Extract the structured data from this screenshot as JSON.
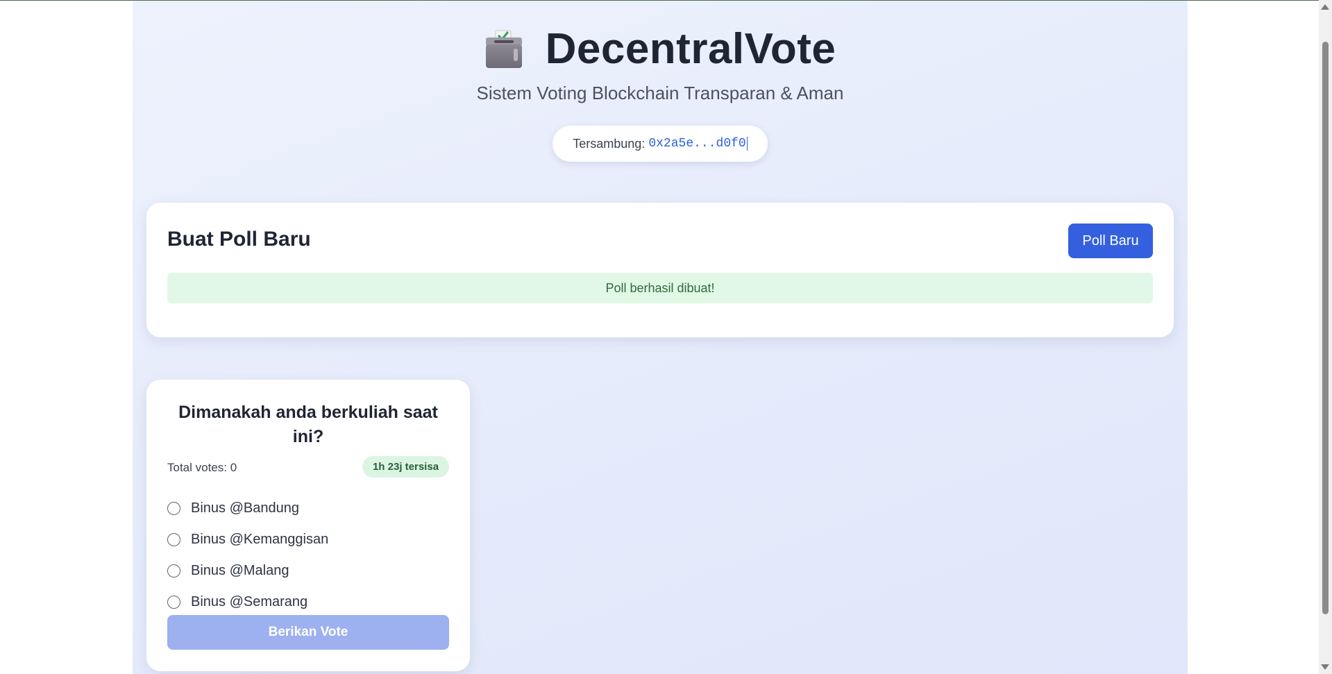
{
  "app": {
    "title": "DecentralVote",
    "subtitle": "Sistem Voting Blockchain Transparan & Aman",
    "logo_icon": "ballot-box-icon"
  },
  "connection": {
    "label": "Tersambung:",
    "address": "0x2a5e...d0f0"
  },
  "create_poll": {
    "title": "Buat Poll Baru",
    "button_label": "Poll Baru",
    "success_message": "Poll berhasil dibuat!"
  },
  "polls": [
    {
      "question": "Dimanakah anda berkuliah saat ini?",
      "total_votes_text": "Total votes: 0",
      "time_remaining": "1h 23j tersisa",
      "options": [
        {
          "label": "Binus @Bandung",
          "selected": false
        },
        {
          "label": "Binus @Kemanggisan",
          "selected": false
        },
        {
          "label": "Binus @Malang",
          "selected": false
        },
        {
          "label": "Binus @Semarang",
          "selected": false
        }
      ],
      "vote_button_label": "Berikan Vote"
    }
  ],
  "colors": {
    "primary": "#3460e0",
    "primary_disabled": "#9db0ef",
    "success_bg": "#e2f8e6",
    "success_text": "#2e6b3a",
    "badge_bg": "#dcf5e2",
    "title_text": "#1e2533"
  }
}
